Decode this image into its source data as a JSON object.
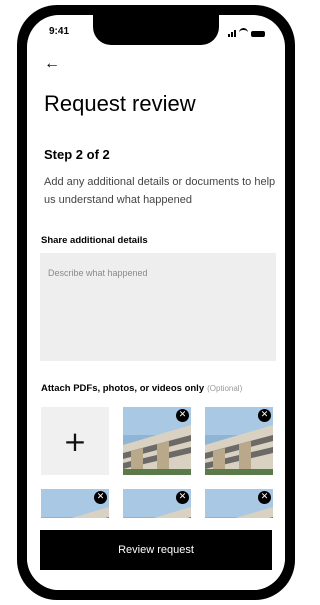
{
  "status_bar": {
    "time": "9:41"
  },
  "header": {
    "back_icon": "arrow-left-icon",
    "title": "Request review"
  },
  "step": {
    "label": "Step 2 of 2"
  },
  "description": "Add any additional details or documents to help us understand what happened",
  "details": {
    "label": "Share additional details",
    "placeholder": "Describe what happened",
    "value": ""
  },
  "attachments": {
    "label": "Attach PDFs, photos, or videos only",
    "optional_label": "(Optional)",
    "add_icon": "plus-icon",
    "remove_icon": "close-icon",
    "photo_count": 5
  },
  "footer": {
    "button_label": "Review request"
  },
  "colors": {
    "primary": "#000000",
    "field_background": "#eeeeee",
    "placeholder_text": "#8a8a8a"
  }
}
